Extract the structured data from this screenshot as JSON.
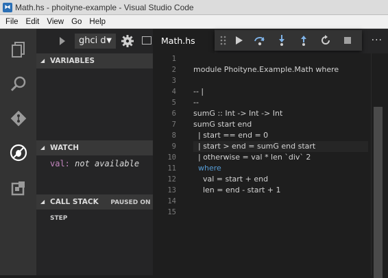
{
  "window": {
    "title": "Math.hs - phoityne-example - Visual Studio Code"
  },
  "menu": [
    "File",
    "Edit",
    "View",
    "Go",
    "Help"
  ],
  "activity_bar": [
    "files-icon",
    "search-icon",
    "git-icon",
    "debug-icon",
    "extensions-icon"
  ],
  "debug": {
    "config_value": "ghci d",
    "dropdown_caret": "▼"
  },
  "sidebar": {
    "variables_title": "VARIABLES",
    "watch_title": "WATCH",
    "watch_items": [
      {
        "name": "val:",
        "value": "not available"
      }
    ],
    "callstack_title": "CALL STACK",
    "callstack_status": "PAUSED ON STEP"
  },
  "editor": {
    "tab_label": "Math.hs",
    "more_label": "···",
    "line_numbers": [
      "1",
      "2",
      "3",
      "4",
      "5",
      "6",
      "7",
      "8",
      "9",
      "10",
      "11",
      "12",
      "13",
      "14",
      "15"
    ],
    "lines": [
      "",
      "module Phoityne.Example.Math where",
      "",
      "-- |",
      "--",
      "sumG :: Int -> Int -> Int",
      "sumG start end",
      "  | start == end = 0",
      "  | start > end = sumG end start",
      "  | otherwise = val * len `div` 2",
      "  where",
      "    val = start + end",
      "    len = end - start + 1",
      "",
      ""
    ]
  },
  "colors": {
    "activity": "#333333",
    "sidebar": "#252526",
    "editor": "#1e1e1e",
    "keyword": "#569cd6"
  }
}
